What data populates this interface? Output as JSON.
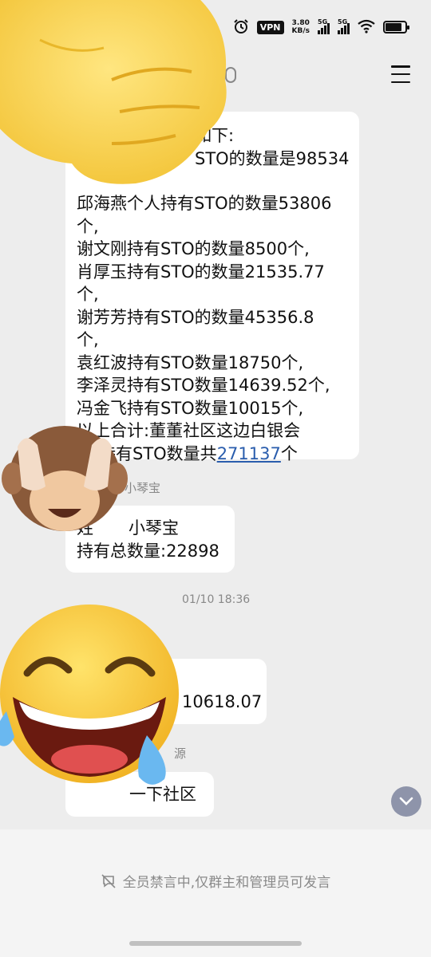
{
  "status_bar": {
    "vpn": "VPN",
    "speed_value": "3.80",
    "speed_unit": "KB/s",
    "sim1": "5G",
    "sim2": "5G"
  },
  "messages": {
    "first_bubble_lines": [
      "如下:",
      "STO的数量是98534",
      "",
      "邱海燕个人持有STO的数量53806",
      "个,",
      "谢文刚持有STO的数量8500个,",
      "肖厚玉持有STO的数量21535.77",
      "个,",
      "谢芳芳持有STO的数量45356.8",
      "个,",
      "袁红波持有STO数量18750个,",
      "李泽灵持有STO数量14639.52个,",
      "冯金飞持有STO数量10015个,",
      "以上合计:董董社区这边白银会",
      "持有STO数量共"
    ],
    "first_bubble_link": "271137",
    "first_bubble_suffix": "个",
    "sender2": "小琴宝",
    "second_bubble_line1": "姓",
    "second_bubble_name": "小琴宝",
    "second_bubble_line2": "持有总数量:22898",
    "timestamp": "01/10 18:36",
    "third_bubble": "10618.07",
    "sender4": "源",
    "fourth_bubble": "一下社区"
  },
  "bottom": {
    "muted_notice": "全员禁言中,仅群主和管理员可发言"
  }
}
